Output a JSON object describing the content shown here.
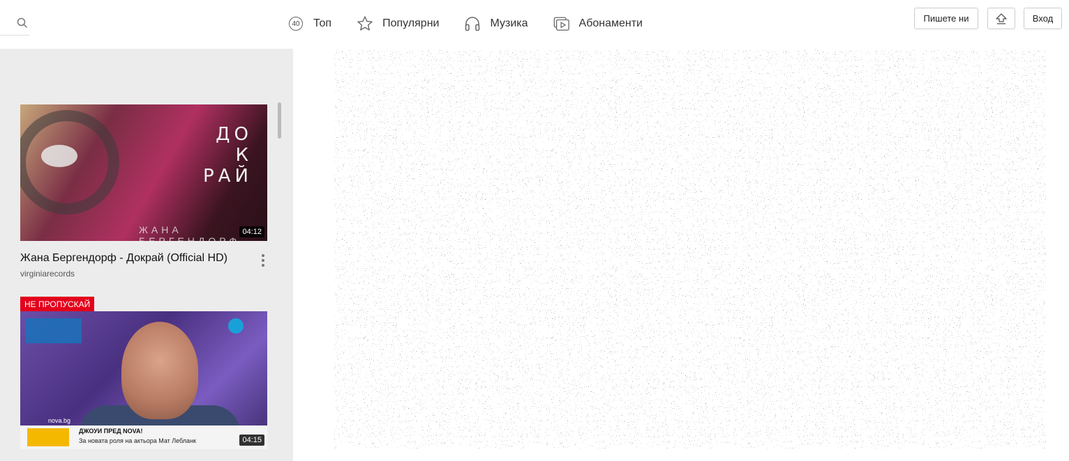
{
  "header": {
    "search_icon": "search-icon",
    "nav": [
      {
        "icon": "top40-badge-icon",
        "badge": "40",
        "label": "Топ"
      },
      {
        "icon": "star-icon",
        "label": "Популярни"
      },
      {
        "icon": "headphones-icon",
        "label": "Музика"
      },
      {
        "icon": "subscriptions-icon",
        "label": "Абонаменти"
      }
    ],
    "contact_label": "Пишете ни",
    "upload_icon": "upload-icon",
    "login_label": "Вход"
  },
  "sidebar": {
    "videos": [
      {
        "title": "Жана Бергендорф - Докрай (Official HD)",
        "channel": "virginiarecords",
        "duration": "04:12",
        "overlay_text": [
          "ДО",
          "К",
          "РАЙ"
        ],
        "overlay_artist": "ЖАНА БЕРГЕНДОРФ"
      },
      {
        "tag": "НЕ ПРОПУСКАЙ",
        "duration": "04:15",
        "headline": "ДЖОУИ ПРЕД NOVA!",
        "subline": "За новата роля на актьора Мат Лебланк",
        "site": "nova.bg"
      }
    ]
  },
  "colors": {
    "accent_red": "#e3001b",
    "sidebar_bg": "#ececec"
  }
}
